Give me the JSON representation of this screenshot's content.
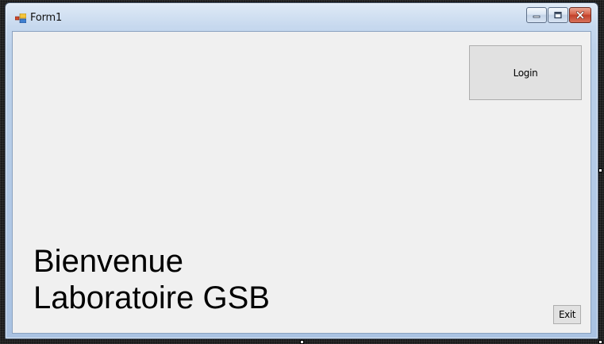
{
  "window": {
    "title": "Form1",
    "icon": "app-form-icon"
  },
  "caption_buttons": {
    "minimize": "minimize-icon",
    "maximize": "maximize-icon",
    "close": "close-icon"
  },
  "form": {
    "login_label": "Login",
    "exit_label": "Exit",
    "welcome_line1": "Bienvenue",
    "welcome_line2": "Laboratoire GSB"
  },
  "colors": {
    "client_background": "#f0f0f0",
    "button_face": "#e1e1e1",
    "close_button": "#c7432d"
  }
}
